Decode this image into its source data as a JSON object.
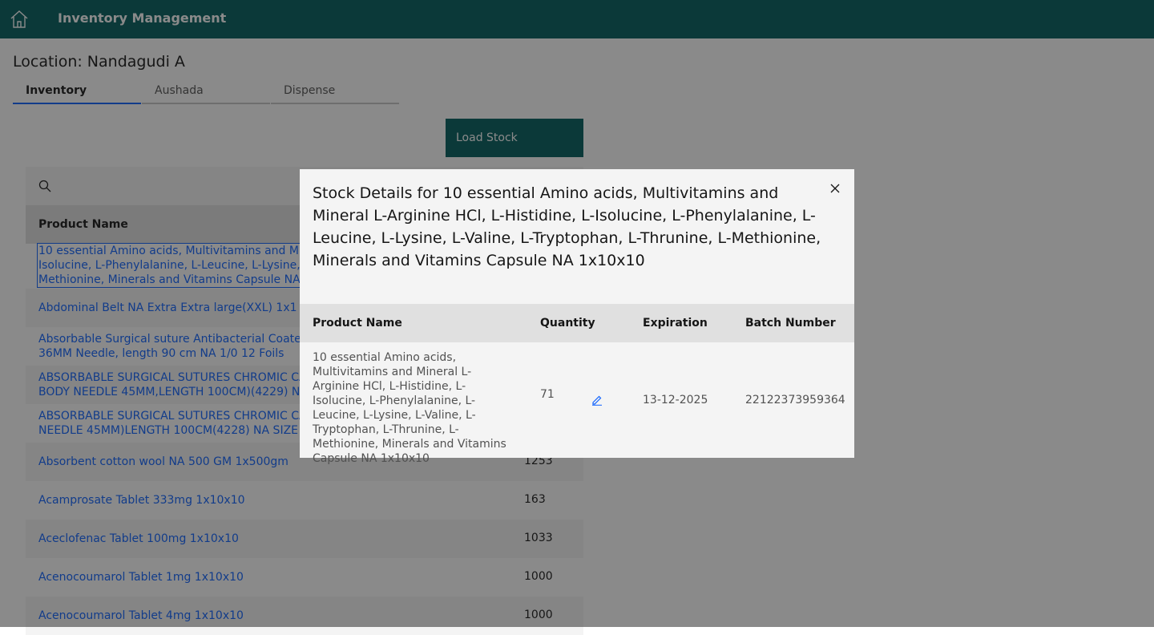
{
  "header": {
    "title": "Inventory Management",
    "home_icon": "home-icon"
  },
  "location": "Location: Nandagudi A",
  "tabs": [
    {
      "label": "Inventory",
      "active": true
    },
    {
      "label": "Aushada",
      "active": false
    },
    {
      "label": "Dispense",
      "active": false
    }
  ],
  "toolbar": {
    "load_stock_label": "Load Stock"
  },
  "search": {
    "icon": "search-icon"
  },
  "table": {
    "header_product": "Product Name",
    "rows": [
      {
        "name": "10 essential Amino acids, Multivitamins and Minera Isolucine, L-Phenylalanine, L-Leucine, L-Lysine, L-V Methionine, Minerals and Vitamins Capsule NA 1x1",
        "qty": ""
      },
      {
        "name": "Abdominal Belt NA Extra Extra large(XXL) 1x1",
        "qty": ""
      },
      {
        "name": "Absorbable Surgical suture Antibacterial Coated Po 36MM Needle, length 90 cm NA 1/0 12 Foils",
        "qty": ""
      },
      {
        "name": "ABSORBABLE SURGICAL SUTURES CHROMIC CATG BODY NEEDLE 45MM,LENGTH 100CM)(4229) NA S",
        "qty": ""
      },
      {
        "name": "ABSORBABLE SURGICAL SUTURES CHROMIC CATG NEEDLE 45MM)LENGTH 100CM(4228) NA SIZE 2 1",
        "qty": ""
      },
      {
        "name": "Absorbent cotton wool NA 500 GM 1x500gm",
        "qty": "1253"
      },
      {
        "name": "Acamprosate Tablet 333mg 1x10x10",
        "qty": "163"
      },
      {
        "name": "Aceclofenac Tablet 100mg 1x10x10",
        "qty": "1033"
      },
      {
        "name": "Acenocoumarol Tablet 1mg 1x10x10",
        "qty": "1000"
      },
      {
        "name": "Acenocoumarol Tablet 4mg 1x10x10",
        "qty": "1000"
      }
    ]
  },
  "modal": {
    "title": "Stock Details for 10 essential Amino acids, Multivitamins and Mineral L-Arginine HCl, L-Histidine, L-Isolucine, L-Phenylalanine, L-Leucine, L-Lysine, L-Valine, L-Tryptophan, L-Thrunine, L-Methionine, Minerals and Vitamins Capsule NA 1x10x10",
    "close_icon": "close-icon",
    "columns": {
      "product": "Product Name",
      "quantity": "Quantity",
      "expiration": "Expiration",
      "batch": "Batch Number"
    },
    "row": {
      "product": "10 essential Amino acids, Multivitamins and Mineral L-Arginine HCl, L-Histidine, L-Isolucine, L-Phenylalanine, L-Leucine, L-Lysine, L-Valine, L-Tryptophan, L-Thrunine, L-Methionine, Minerals and Vitamins Capsule NA 1x10x10",
      "quantity": "71",
      "edit_icon": "edit-icon",
      "expiration": "13-12-2025",
      "batch": "22122373959364"
    }
  }
}
